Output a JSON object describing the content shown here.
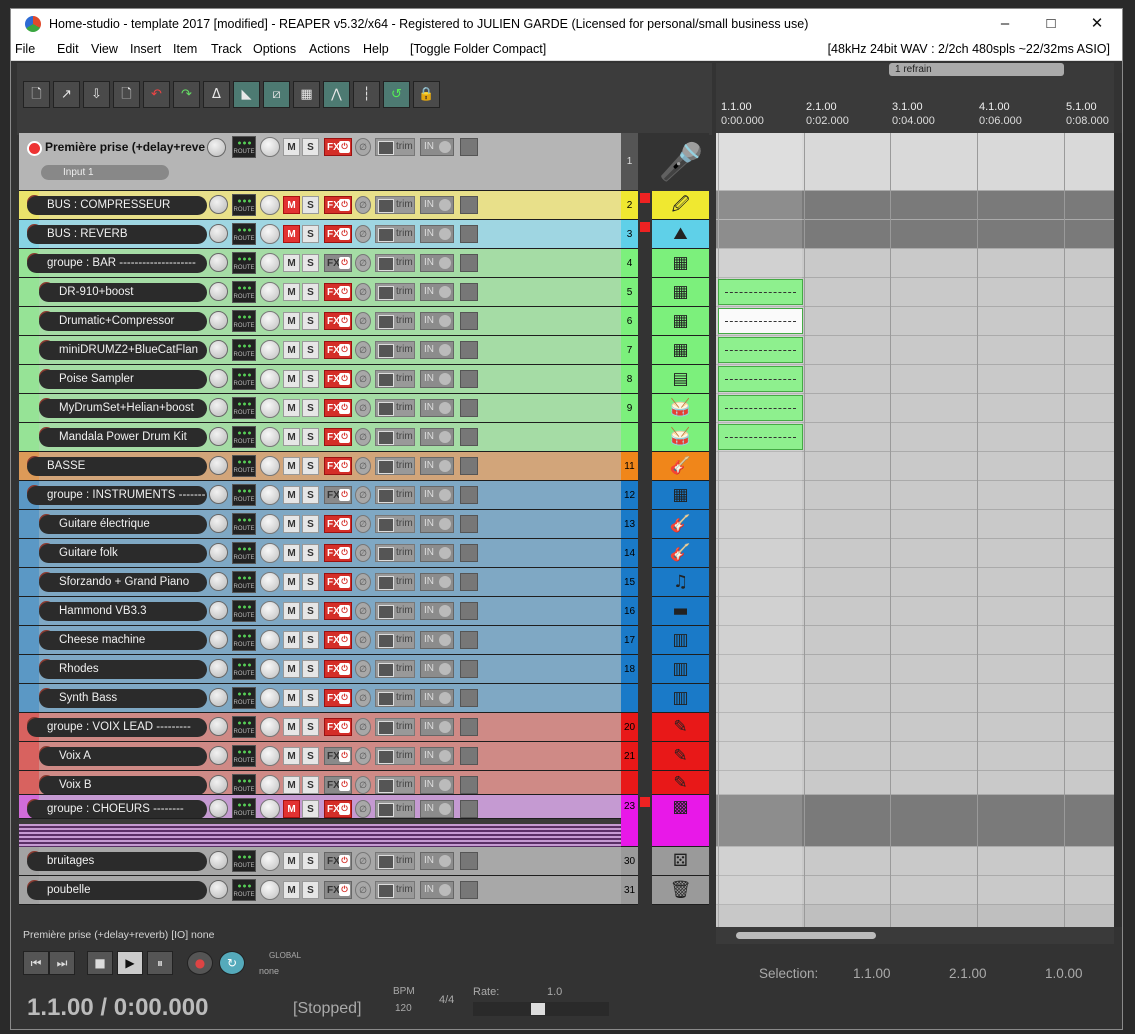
{
  "window": {
    "title": "Home-studio - template 2017 [modified] - REAPER v5.32/x64 - Registered to JULIEN GARDE (Licensed for personal/small business use)",
    "minimize": "–",
    "maximize": "□",
    "close": "✕"
  },
  "menu": {
    "items": [
      "File",
      "Edit",
      "View",
      "Insert",
      "Item",
      "Track",
      "Options",
      "Actions",
      "Help",
      "[Toggle Folder Compact]"
    ],
    "status": "[48kHz 24bit WAV : 2/2ch 480spls ~22/32ms ASIO]"
  },
  "ruler": {
    "marks": [
      {
        "bar": "1.1.00",
        "time": "0:00.000"
      },
      {
        "bar": "2.1.00",
        "time": "0:02.000"
      },
      {
        "bar": "3.1.00",
        "time": "0:04.000"
      },
      {
        "bar": "4.1.00",
        "time": "0:06.000"
      },
      {
        "bar": "5.1.00",
        "time": "0:08.000"
      }
    ],
    "region": "1  refrain"
  },
  "first_track": {
    "name": "Première prise (+delay+rever",
    "input": "Input 1",
    "number": "1"
  },
  "labels": {
    "route": "ROUTE",
    "m": "M",
    "s": "S",
    "fx": "FX",
    "trim": "trim",
    "in": "IN"
  },
  "tracks": [
    {
      "name": "BUS : COMPRESSEUR",
      "num": "2",
      "color": "#e8e08a",
      "numcolor": "#f0e830",
      "mute": true,
      "fxon": true,
      "icon": "🖉"
    },
    {
      "name": "BUS : REVERB",
      "num": "3",
      "color": "#9fd6e2",
      "numcolor": "#5fd0e8",
      "mute": true,
      "fxon": true,
      "icon": "⛰"
    },
    {
      "name": "groupe : BAR --------------------",
      "num": "4",
      "color": "#a5dca5",
      "numcolor": "#7cf07c",
      "mute": false,
      "fxon": false,
      "icon": "▦"
    },
    {
      "name": "DR-910+boost",
      "num": "5",
      "color": "#a5dca5",
      "numcolor": "#7cf07c",
      "mute": false,
      "fxon": true,
      "icon": "▦",
      "child": true
    },
    {
      "name": "Drumatic+Compressor",
      "num": "6",
      "color": "#a5dca5",
      "numcolor": "#7cf07c",
      "mute": false,
      "fxon": true,
      "icon": "▦",
      "child": true
    },
    {
      "name": "miniDRUMZ2+BlueCatFlan",
      "num": "7",
      "color": "#a5dca5",
      "numcolor": "#7cf07c",
      "mute": false,
      "fxon": true,
      "icon": "▦",
      "child": true
    },
    {
      "name": "Poise Sampler",
      "num": "8",
      "color": "#a5dca5",
      "numcolor": "#7cf07c",
      "mute": false,
      "fxon": true,
      "icon": "▤",
      "child": true
    },
    {
      "name": "MyDrumSet+Helian+boost",
      "num": "9",
      "color": "#a5dca5",
      "numcolor": "#7cf07c",
      "mute": false,
      "fxon": true,
      "icon": "🥁",
      "child": true
    },
    {
      "name": "Mandala Power Drum Kit",
      "num": "",
      "color": "#a5dca5",
      "numcolor": "#7cf07c",
      "mute": false,
      "fxon": true,
      "icon": "🥁",
      "child": true
    },
    {
      "name": "BASSE",
      "num": "11",
      "color": "#d2a57a",
      "numcolor": "#f0861a",
      "mute": false,
      "fxon": true,
      "icon": "🎸"
    },
    {
      "name": "groupe : INSTRUMENTS -------",
      "num": "12",
      "color": "#7fa8c4",
      "numcolor": "#1a7ac8",
      "mute": false,
      "fxon": false,
      "icon": "▦"
    },
    {
      "name": "Guitare électrique",
      "num": "13",
      "color": "#7fa8c4",
      "numcolor": "#1a7ac8",
      "mute": false,
      "fxon": true,
      "icon": "🎸",
      "child": true
    },
    {
      "name": "Guitare folk",
      "num": "14",
      "color": "#7fa8c4",
      "numcolor": "#1a7ac8",
      "mute": false,
      "fxon": true,
      "icon": "🎸",
      "child": true
    },
    {
      "name": "Sforzando + Grand Piano",
      "num": "15",
      "color": "#7fa8c4",
      "numcolor": "#1a7ac8",
      "mute": false,
      "fxon": true,
      "icon": "♫",
      "child": true
    },
    {
      "name": "Hammond VB3.3",
      "num": "16",
      "color": "#7fa8c4",
      "numcolor": "#1a7ac8",
      "mute": false,
      "fxon": true,
      "icon": "▬",
      "child": true
    },
    {
      "name": "Cheese machine",
      "num": "17",
      "color": "#7fa8c4",
      "numcolor": "#1a7ac8",
      "mute": false,
      "fxon": true,
      "icon": "▥",
      "child": true
    },
    {
      "name": "Rhodes",
      "num": "18",
      "color": "#7fa8c4",
      "numcolor": "#1a7ac8",
      "mute": false,
      "fxon": true,
      "icon": "▥",
      "child": true
    },
    {
      "name": "Synth Bass",
      "num": "",
      "color": "#7fa8c4",
      "numcolor": "#1a7ac8",
      "mute": false,
      "fxon": true,
      "icon": "▥",
      "child": true
    },
    {
      "name": "groupe : VOIX LEAD ---------",
      "num": "20",
      "color": "#cf8a86",
      "numcolor": "#e81818",
      "mute": false,
      "fxon": true,
      "icon": "✎"
    },
    {
      "name": "Voix A",
      "num": "21",
      "color": "#cf8a86",
      "numcolor": "#e81818",
      "mute": false,
      "fxon": false,
      "icon": "✎",
      "child": true
    },
    {
      "name": "Voix B",
      "num": "",
      "color": "#cf8a86",
      "numcolor": "#e81818",
      "mute": false,
      "fxon": false,
      "icon": "✎",
      "child": true
    },
    {
      "name": "groupe : CHOEURS --------",
      "num": "23",
      "color": "#c59ad2",
      "numcolor": "#e818e8",
      "mute": true,
      "fxon": true,
      "icon": "▩"
    },
    {
      "name": "bruitages",
      "num": "30",
      "color": "#a8a8a8",
      "numcolor": "#9a9a9a",
      "mute": false,
      "fxon": false,
      "icon": "⚄"
    },
    {
      "name": "poubelle",
      "num": "31",
      "color": "#a8a8a8",
      "numcolor": "#9a9a9a",
      "mute": false,
      "fxon": false,
      "icon": "🗑"
    }
  ],
  "status_line": "Première prise (+delay+reverb) [IO] none",
  "transport": {
    "position": "1.1.00 / 0:00.000",
    "state": "[Stopped]",
    "bpm_label": "BPM",
    "bpm": "120",
    "timesig": "4/4",
    "rate_label": "Rate:",
    "rate": "1.0",
    "global": "GLOBAL",
    "none": "none",
    "selection_label": "Selection:",
    "sel_start": "1.1.00",
    "sel_end": "2.1.00",
    "sel_len": "1.0.00"
  },
  "toolbar_icons": [
    "new-project-icon",
    "open-icon",
    "save-icon",
    "project-settings-icon",
    "undo-icon",
    "redo-icon",
    "metronome-icon",
    "snap-icon",
    "ripple-icon",
    "grid-icon",
    "autocross-icon",
    "envelope-icon",
    "markers-icon",
    "loop-icon",
    "lock-icon"
  ]
}
